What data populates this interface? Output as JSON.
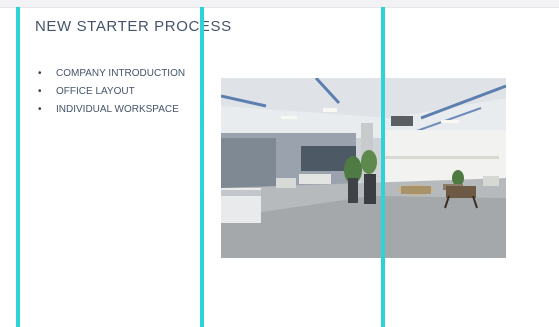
{
  "slide": {
    "title": "NEW STARTER PROCESS",
    "bullets": [
      "COMPANY INTRODUCTION",
      "OFFICE LAYOUT",
      "INDIVIDUAL WORKSPACE"
    ]
  },
  "colors": {
    "guide": "#2ed3d8",
    "text": "#44546a"
  },
  "image": {
    "subject": "open-plan-office-photo"
  }
}
